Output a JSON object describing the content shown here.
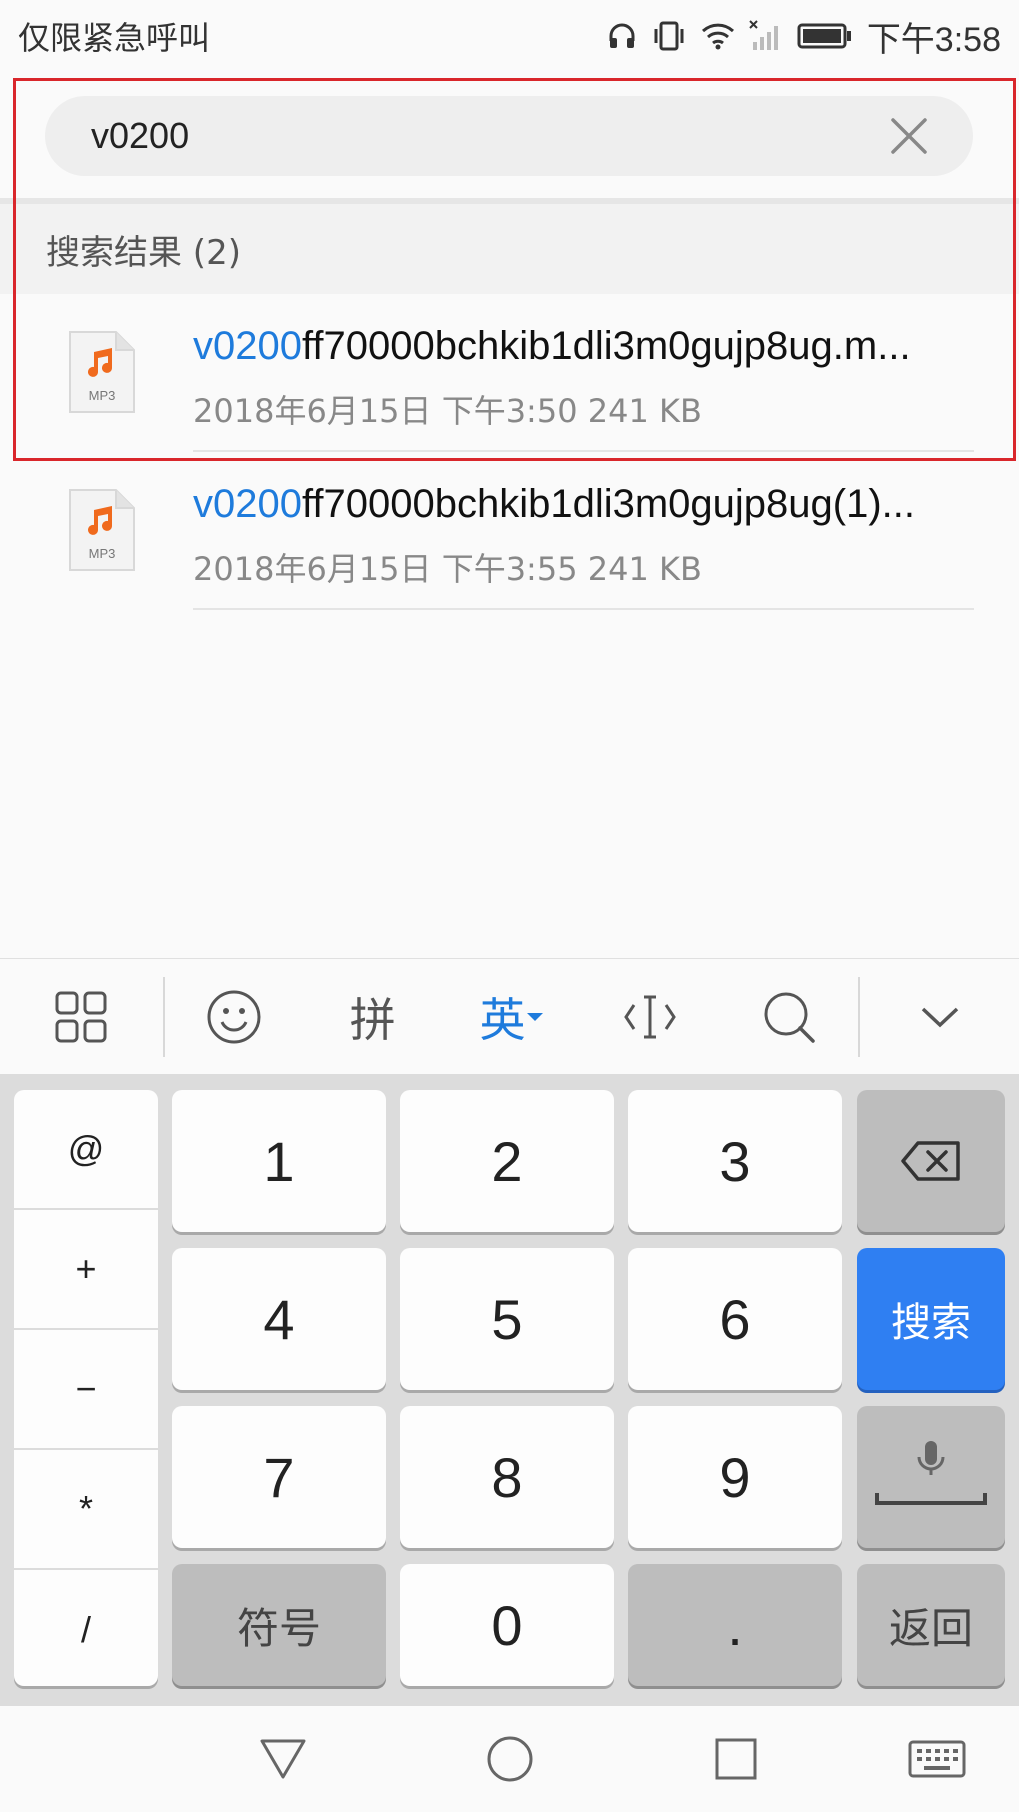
{
  "status_bar": {
    "carrier_text": "仅限紧急呼叫",
    "time": "下午3:58"
  },
  "search": {
    "query": "v0200",
    "clear_icon": "close-icon"
  },
  "results": {
    "header": "搜索结果 (2)",
    "items": [
      {
        "highlight": "v0200",
        "rest": "ff70000bchkib1dli3m0gujp8ug.m...",
        "meta": "2018年6月15日 下午3:50 241 KB",
        "icon_label": "MP3"
      },
      {
        "highlight": "v0200",
        "rest": "ff70000bchkib1dli3m0gujp8ug(1)...",
        "meta": "2018年6月15日 下午3:55 241 KB",
        "icon_label": "MP3"
      }
    ]
  },
  "keyboard": {
    "toolbar": {
      "pinyin": "拼",
      "english": "英"
    },
    "symbols": [
      "@",
      "+",
      "−",
      "*",
      "/"
    ],
    "digits": [
      "1",
      "2",
      "3",
      "4",
      "5",
      "6",
      "7",
      "8",
      "9",
      "0"
    ],
    "symbol_key": "符号",
    "dot_key": ".",
    "search_key": "搜索",
    "back_key": "返回"
  },
  "colors": {
    "accent": "#1e7bdc",
    "search_key": "#2f7ff2",
    "highlight_box": "#d9262b",
    "music_icon": "#f06a1d"
  }
}
